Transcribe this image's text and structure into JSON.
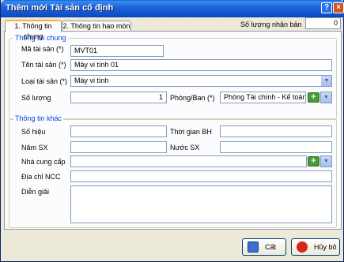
{
  "window": {
    "title": "Thêm mới Tài sản cố định"
  },
  "titlebar": {
    "help_label": "?",
    "close_label": "×"
  },
  "tabs": [
    {
      "label": "1. Thông tin chung",
      "active": true
    },
    {
      "label": "2. Thông tin hao mòn",
      "active": false
    }
  ],
  "copies": {
    "label": "Số lượng nhân bản",
    "value": "0"
  },
  "general": {
    "title": "Thông tin chung",
    "code": {
      "label": "Mã tài sản (*)",
      "value": "MVT01"
    },
    "name": {
      "label": "Tên tài sản (*)",
      "value": "Máy vi tính 01"
    },
    "type": {
      "label": "Loại tài sản (*)",
      "value": "Máy vi tính"
    },
    "quantity": {
      "label": "Số lượng",
      "value": "1"
    },
    "department": {
      "label": "Phòng/Ban (*)",
      "value": "Phòng Tài chính - Kế toán"
    }
  },
  "other": {
    "title": "Thông tin khác",
    "serial": {
      "label": "Số hiệu",
      "value": ""
    },
    "warranty": {
      "label": "Thời gian BH",
      "value": ""
    },
    "year": {
      "label": "Năm SX",
      "value": ""
    },
    "country": {
      "label": "Nước SX",
      "value": ""
    },
    "supplier": {
      "label": "Nhà cung cấp",
      "value": ""
    },
    "supplier_address": {
      "label": "Địa chỉ NCC",
      "value": ""
    },
    "notes": {
      "label": "Diễn giải",
      "value": ""
    }
  },
  "actions": {
    "save_label": "Cất",
    "cancel_label": "Hủy bỏ"
  },
  "colors": {
    "accent": "#0046d5",
    "titlebar": "#0d4ec8",
    "add_icon": "#4a9a3a",
    "cancel_icon": "#d8281c"
  }
}
